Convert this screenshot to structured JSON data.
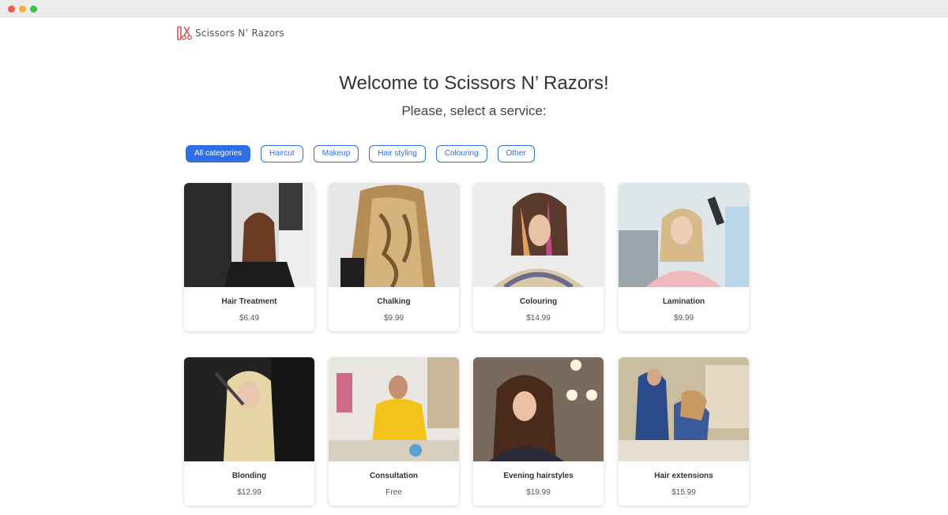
{
  "brand": {
    "name": "Scissors N’ Razors",
    "accent": "#2f6fe4",
    "logo_color": "#d9534f"
  },
  "header": {
    "title": "Welcome to Scissors N’ Razors!",
    "subtitle": "Please, select a service:"
  },
  "filters": [
    {
      "label": "All categories",
      "active": true
    },
    {
      "label": "Haircut",
      "active": false
    },
    {
      "label": "Makeup",
      "active": false
    },
    {
      "label": "Hair styling",
      "active": false
    },
    {
      "label": "Colouring",
      "active": false
    },
    {
      "label": "Other",
      "active": false
    }
  ],
  "services": [
    {
      "name": "Hair Treatment",
      "price": "$6.49",
      "image": "salon-photo"
    },
    {
      "name": "Chalking",
      "price": "$9.99",
      "image": "salon-photo"
    },
    {
      "name": "Colouring",
      "price": "$14.99",
      "image": "salon-photo"
    },
    {
      "name": "Lamination",
      "price": "$9.99",
      "image": "salon-photo"
    },
    {
      "name": "Blonding",
      "price": "$12.99",
      "image": "salon-photo"
    },
    {
      "name": "Consultation",
      "price": "Free",
      "image": "salon-photo"
    },
    {
      "name": "Evening hairstyles",
      "price": "$19.99",
      "image": "salon-photo"
    },
    {
      "name": "Hair extensions",
      "price": "$15.99",
      "image": "salon-photo"
    }
  ]
}
